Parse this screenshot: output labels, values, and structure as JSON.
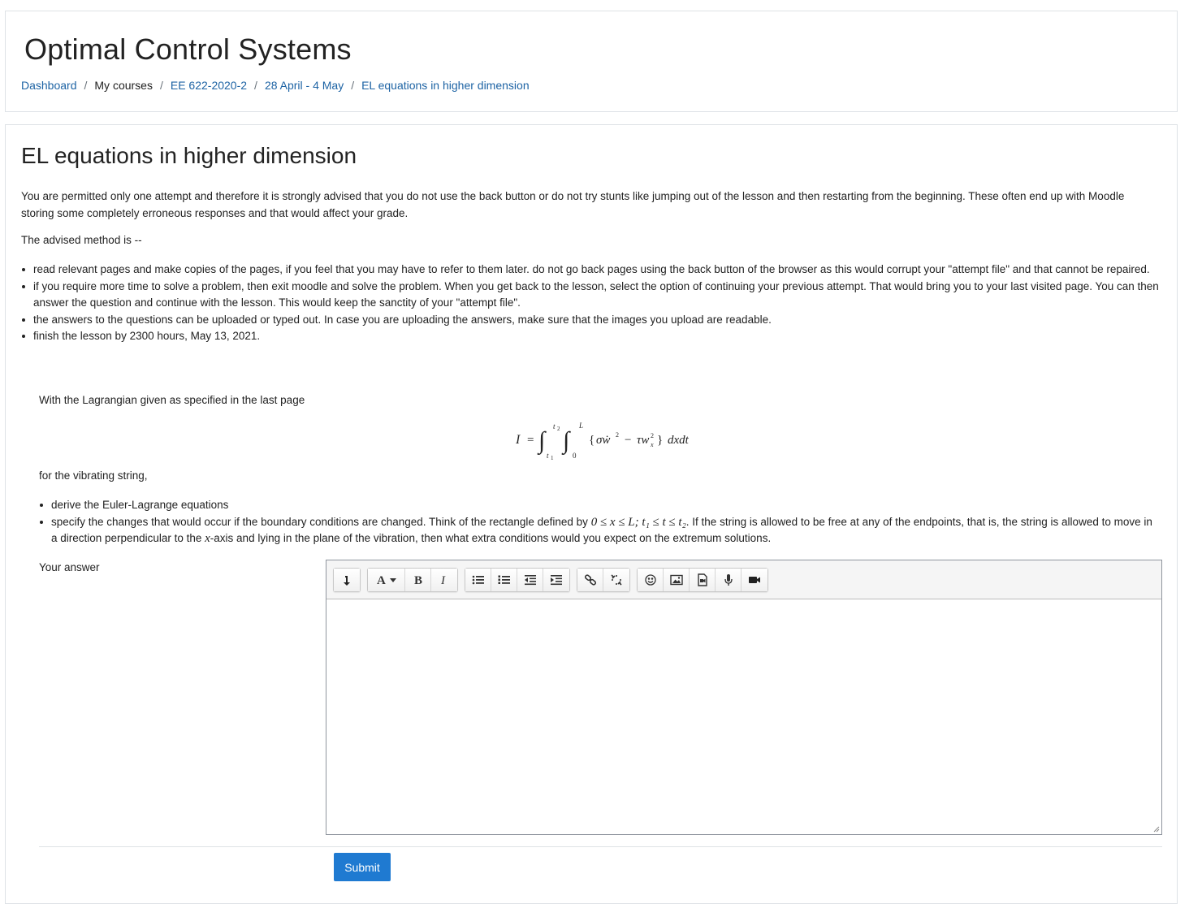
{
  "header": {
    "site_title": "Optimal Control Systems",
    "breadcrumb": [
      "Dashboard",
      "My courses",
      "EE 622-2020-2",
      "28 April - 4 May",
      "EL equations in higher dimension"
    ],
    "breadcrumb_sep": "/"
  },
  "lesson": {
    "title": "EL equations in higher dimension",
    "intro": "You are permitted only one attempt and therefore it is strongly advised that you do not use the back button or do not try stunts like jumping out of the lesson and then restarting from the beginning. These often end up with Moodle storing some completely erroneous responses and that would affect your grade.",
    "advised": "The advised method is --",
    "rules": [
      "read relevant pages and make copies of the pages, if you feel that you may have to refer to them later. do not go back pages using the back button of the browser as this would corrupt your \"attempt file\" and that cannot be repaired.",
      "if you require more time to solve a problem, then exit moodle and solve the problem. When you get back to the lesson, select the option of continuing your previous attempt. That would bring you to your last visited page. You can then answer the question and continue with the lesson. This would keep the sanctity of your \"attempt file\".",
      "the answers to the questions can be uploaded or typed out. In case you are uploading the answers, make sure that the images you upload are readable.",
      "finish the lesson by 2300 hours, May 13, 2021."
    ]
  },
  "question": {
    "text1": "With the Lagrangian given as specified in the last page",
    "text2": "for the vibrating string,",
    "item1": "derive the Euler-Lagrange equations",
    "item2_a": "specify the changes that would occur if the boundary conditions are changed. Think of the rectangle defined by ",
    "item2_math1": "0 ≤ x ≤ L;  t₁ ≤ t ≤ t₂",
    "item2_b": ". If the string is allowed to be free at any of the endpoints, that is, the string is allowed to move in a direction perpendicular to the ",
    "item2_math2": "x",
    "item2_c": "-axis and lying in the plane of the vibration, then what extra conditions would you expect on the extremum solutions."
  },
  "answer": {
    "label": "Your answer",
    "value": "",
    "toolbar_icons": [
      "collapse-icon",
      "font-color-icon",
      "bold-icon",
      "italic-icon",
      "unordered-list-icon",
      "ordered-list-icon",
      "outdent-icon",
      "indent-icon",
      "link-icon",
      "unlink-icon",
      "emoji-icon",
      "image-icon",
      "media-icon",
      "record-audio-icon",
      "record-video-icon"
    ]
  },
  "actions": {
    "submit_label": "Submit"
  },
  "colors": {
    "link": "#1d63a4",
    "submit_bg": "#1f7ad1"
  }
}
